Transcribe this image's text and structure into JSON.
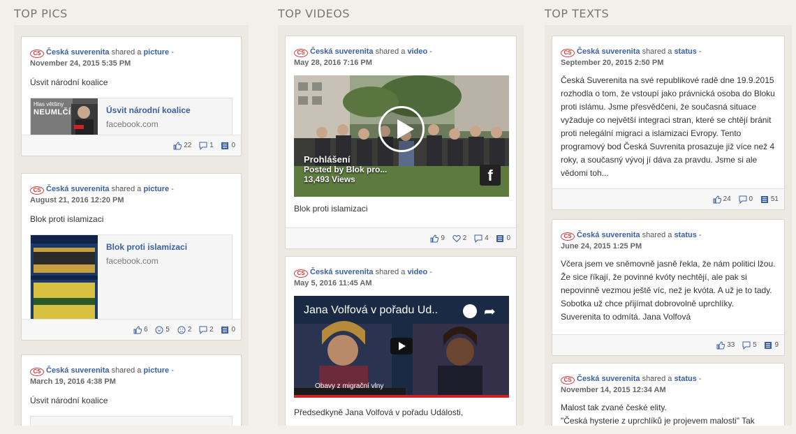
{
  "columns": {
    "pics": {
      "title": "TOP PICS",
      "cards": [
        {
          "logo": "CS",
          "page": "Česká suverenita",
          "shared_text": "shared a",
          "type": "picture",
          "sep": "-",
          "date": "November 24, 2015 5:35 PM",
          "message": "Úsvit národní koalice",
          "link": {
            "title": "Úsvit národní koalice",
            "domain": "facebook.com",
            "thumb_text_1": "Hlas většiny",
            "thumb_text_2": "NEUMLČÍ"
          },
          "stats": {
            "likes": "22",
            "comments": "1",
            "shares": "0"
          }
        },
        {
          "logo": "CS",
          "page": "Česká suverenita",
          "shared_text": "shared a",
          "type": "picture",
          "sep": "-",
          "date": "August 21, 2016 12:20 PM",
          "message": "Blok proti islamizaci",
          "link": {
            "title": "Blok proti islamizaci",
            "domain": "facebook.com"
          },
          "stats": {
            "likes": "6",
            "haha": "5",
            "sad": "2",
            "comments": "2",
            "shares": "0"
          }
        },
        {
          "logo": "CS",
          "page": "Česká suverenita",
          "shared_text": "shared a",
          "type": "picture",
          "sep": "-",
          "date": "March 19, 2016 4:38 PM",
          "message": "Úsvit národní koalice"
        }
      ]
    },
    "videos": {
      "title": "TOP VIDEOS",
      "cards": [
        {
          "logo": "CS",
          "page": "Česká suverenita",
          "shared_text": "shared a",
          "type": "video",
          "sep": "-",
          "date": "May 28, 2016 7:16 PM",
          "video": {
            "title": "Prohlášení",
            "posted": "Posted by Blok pro...",
            "views": "13,493 Views"
          },
          "message": "Blok proti islamizaci",
          "stats": {
            "likes": "9",
            "loves": "2",
            "comments": "4",
            "shares": "0"
          }
        },
        {
          "logo": "CS",
          "page": "Česká suverenita",
          "shared_text": "shared a",
          "type": "video",
          "sep": "-",
          "date": "May 5, 2016 11:45 AM",
          "video": {
            "title": "Jana Volfová v pořadu Ud..",
            "banner": "Obavy z migrační vlny"
          },
          "message": "Předsedkyně Jana Volfová v pořadu Události,"
        }
      ]
    },
    "texts": {
      "title": "TOP TEXTS",
      "cards": [
        {
          "logo": "CS",
          "page": "Česká suverenita",
          "shared_text": "shared a",
          "type": "status",
          "sep": "-",
          "date": "September 20, 2015 2:50 PM",
          "message": "Česká Suverenita na své republikové radě dne 19.9.2015 rozhodla o tom, že vstoupí jako právnická osoba do Bloku proti islámu. Jsme přesvědčeni, že současná situace vyžaduje co největší integraci stran, které se chtějí bránit proti nelegální migraci a islamizaci Evropy. Tento programový bod Česká Suvrenita prosazuje již více než 4 roky, a současný vývoj jí dáva za pravdu. Jsme si ale vědomi toh...",
          "stats": {
            "likes": "24",
            "comments": "0",
            "shares": "51"
          }
        },
        {
          "logo": "CS",
          "page": "Česká suverenita",
          "shared_text": "shared a",
          "type": "status",
          "sep": "-",
          "date": "June 24, 2015 1:25 PM",
          "message": "Včera jsem ve sněmovně jasně řekla, že nám politici lžou. Že sice říkají, že povinné kvóty nechtějí, ale pak si nepovinně vezmou ještě víc, než je kvóta. A už je to tady. Sobotka už chce přijímat dobrovolně uprchlíky. Suverenita to odmítá. Jana Volfová",
          "stats": {
            "likes": "33",
            "comments": "5",
            "shares": "9"
          }
        },
        {
          "logo": "CS",
          "page": "Česká suverenita",
          "shared_text": "shared a",
          "type": "status",
          "sep": "-",
          "date": "November 14, 2015 12:34 AM",
          "message": "Malost tak zvané české elity.",
          "message_2": "\"Česká hysterie z uprchlíků je projevem malosti\" Tak"
        }
      ]
    }
  },
  "colors": {
    "accent": "#3b5fa6",
    "logo": "#d43a3a",
    "background": "#f2f0eb"
  }
}
